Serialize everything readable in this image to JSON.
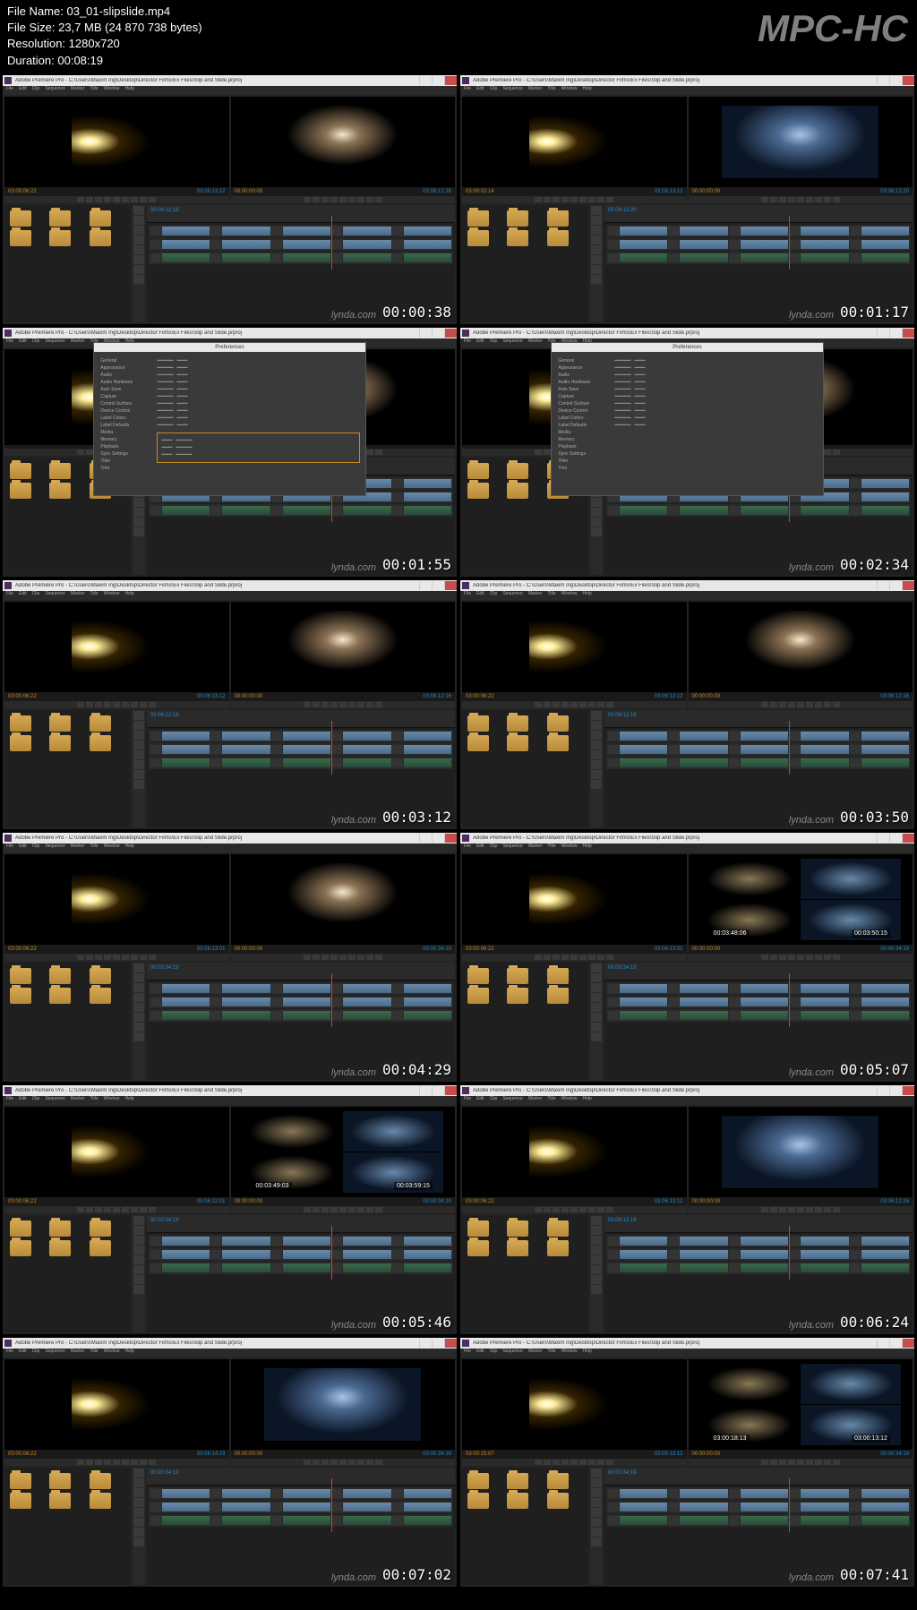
{
  "header": {
    "filename_label": "File Name:",
    "filename": "03_01-slipslide.mp4",
    "filesize_label": "File Size:",
    "filesize": "23,7 MB (24 870 738 bytes)",
    "resolution_label": "Resolution:",
    "resolution": "1280x720",
    "duration_label": "Duration:",
    "duration": "00:08:19",
    "watermark": "MPC-HC"
  },
  "app": {
    "title": "Adobe Premiere Pro - C:\\Users\\Maxim Ing\\Desktop\\Director Films\\Ex Files\\Slip and Slide.prproj",
    "menu": [
      "File",
      "Edit",
      "Clip",
      "Sequence",
      "Marker",
      "Title",
      "Window",
      "Help"
    ],
    "dialog_title": "Preferences",
    "dialog_sidebar": [
      "General",
      "Appearance",
      "Audio",
      "Audio Hardware",
      "Auto Save",
      "Capture",
      "Control Surface",
      "Device Control",
      "Label Colors",
      "Label Defaults",
      "Media",
      "Memory",
      "Playback",
      "Sync Settings",
      "Titler",
      "Trim"
    ],
    "lynda": "lynda.com"
  },
  "thumbs": [
    {
      "ts": "00:00:38",
      "tc1": "03:00:06:22",
      "tc2": "03:06:13:12",
      "tc3": "00:00:00:00",
      "tc4": "03:06:12:16",
      "dialog": false,
      "blue": false,
      "quad": false
    },
    {
      "ts": "00:01:17",
      "tc1": "03:00:02:14",
      "tc2": "03:06:13:12",
      "tc3": "00:00:00:00",
      "tc4": "03:06:12:20",
      "dialog": false,
      "blue": true,
      "quad": false
    },
    {
      "ts": "00:01:55",
      "tc1": "",
      "tc2": "",
      "tc3": "",
      "tc4": "",
      "dialog": true,
      "hl": true,
      "blue": false,
      "quad": false
    },
    {
      "ts": "00:02:34",
      "tc1": "",
      "tc2": "",
      "tc3": "",
      "tc4": "",
      "dialog": true,
      "hl": false,
      "blue": false,
      "quad": false
    },
    {
      "ts": "00:03:12",
      "tc1": "03:00:06:22",
      "tc2": "03:06:13:12",
      "tc3": "00:00:00:00",
      "tc4": "03:06:12:16",
      "dialog": false,
      "blue": false,
      "quad": false
    },
    {
      "ts": "00:03:50",
      "tc1": "03:00:06:22",
      "tc2": "03:06:13:12",
      "tc3": "00:00:00:00",
      "tc4": "03:06:12:16",
      "dialog": false,
      "blue": false,
      "quad": false
    },
    {
      "ts": "00:04:29",
      "tc1": "03:00:06:22",
      "tc2": "03:06:13:01",
      "tc3": "00:00:00:00",
      "tc4": "00:00:34:19",
      "dialog": false,
      "blue": false,
      "quad": false
    },
    {
      "ts": "00:05:07",
      "tc1": "03:00:06:22",
      "tc2": "03:06:13:01",
      "tc3": "00:00:00:00",
      "tc4": "00:00:34:19",
      "dialog": false,
      "blue": true,
      "quad": true,
      "ov1": "00:03:48:06",
      "ov2": "00:03:50:15"
    },
    {
      "ts": "00:05:46",
      "tc1": "03:00:06:22",
      "tc2": "03:06:12:01",
      "tc3": "00:00:00:00",
      "tc4": "00:00:34:19",
      "dialog": false,
      "blue": true,
      "quad": true,
      "ov1": "00:03:49:03",
      "ov2": "00:03:59:15"
    },
    {
      "ts": "00:06:24",
      "tc1": "03:00:06:22",
      "tc2": "03:06:13:12",
      "tc3": "00:00:00:00",
      "tc4": "03:06:12:16",
      "dialog": false,
      "blue": true,
      "quad": false
    },
    {
      "ts": "00:07:02",
      "tc1": "03:00:06:22",
      "tc2": "03:06:14:19",
      "tc3": "00:00:00:00",
      "tc4": "00:00:34:19",
      "dialog": false,
      "blue": true,
      "quad": false
    },
    {
      "ts": "00:07:41",
      "tc1": "03:00:15:07",
      "tc2": "03:00:13:12",
      "tc3": "00:00:00:00",
      "tc4": "00:00:34:19",
      "dialog": false,
      "blue": false,
      "quad": true,
      "ov1": "03:00:18:13",
      "ov2": "03:00:13:12"
    }
  ]
}
